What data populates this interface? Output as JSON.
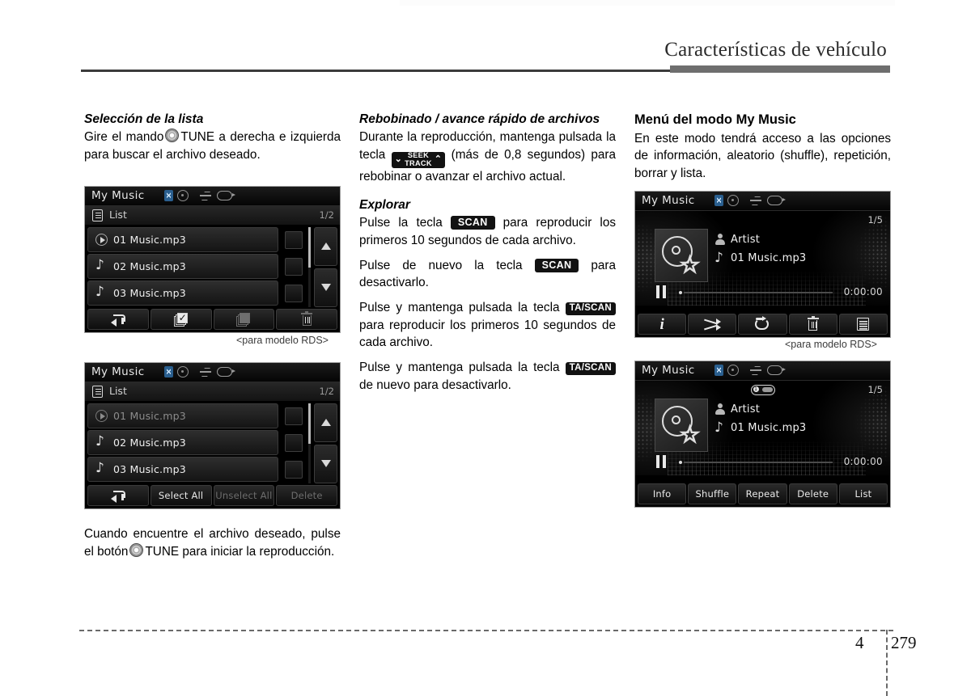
{
  "page": {
    "header_title": "Características de vehículo",
    "chapter": "4",
    "number": "279"
  },
  "columns": {
    "left": {
      "section_title": "Selección de la lista",
      "paragraph_1a": "Gire el mando",
      "paragraph_1b": "TUNE a derecha e izquierda para buscar el archivo deseado.",
      "caption": "<para modelo RDS>",
      "paragraph_2a": "Cuando encuentre el archivo deseado, pulse el botón",
      "paragraph_2b": "TUNE para iniciar la reproducción."
    },
    "middle": {
      "section_title_1": "Rebobinado / avance rápido de archivos",
      "para_1a": "Durante la reproducción, mantenga pulsada la tecla",
      "seek_key_top": "SEEK",
      "seek_key_bottom": "TRACK",
      "para_1b": "(más de 0,8 segundos) para rebobinar o avanzar el archivo actual.",
      "section_title_2": "Explorar",
      "para_2a": "Pulse la tecla",
      "scan_key": "SCAN",
      "para_2b": "para reproducir los primeros 10 segundos de cada archivo.",
      "para_3a": "Pulse de nuevo la tecla",
      "para_3b": "para desactivarlo.",
      "para_4a": "Pulse y mantenga pulsada la tecla",
      "ta_scan_key": "TA/SCAN",
      "para_4b": "para reproducir los primeros 10 segundos de cada archivo.",
      "para_5a": "Pulse y mantenga pulsada la tecla",
      "para_5b": "de nuevo para desactivarlo."
    },
    "right": {
      "section_title": "Menú del modo My Music",
      "paragraph": "En este modo tendrá acceso a las opciones de información, aleatorio (shuffle), repetición, borrar y lista.",
      "caption": "<para modelo RDS>"
    }
  },
  "screens": {
    "list_rds": {
      "title": "My Music",
      "list_label": "List",
      "page_indicator": "1/2",
      "rows": [
        {
          "label": "01 Music.mp3",
          "icon": "play-icon"
        },
        {
          "label": "02 Music.mp3",
          "icon": "music-note-icon"
        },
        {
          "label": "03 Music.mp3",
          "icon": "music-note-icon"
        }
      ],
      "toolbar": [
        {
          "name": "back-button",
          "icon": "back-arrow-icon"
        },
        {
          "name": "select-all-button",
          "icon": "checked-pages-icon"
        },
        {
          "name": "unselect-all-button",
          "icon": "blank-pages-icon"
        },
        {
          "name": "delete-button",
          "icon": "trash-icon"
        }
      ]
    },
    "list_text": {
      "title": "My Music",
      "list_label": "List",
      "page_indicator": "1/2",
      "rows": [
        {
          "label": "01 Music.mp3",
          "icon": "play-icon"
        },
        {
          "label": "02 Music.mp3",
          "icon": "music-note-icon"
        },
        {
          "label": "03 Music.mp3",
          "icon": "music-note-icon"
        }
      ],
      "toolbar": [
        {
          "name": "back-button",
          "label": ""
        },
        {
          "name": "select-all-button",
          "label": "Select All"
        },
        {
          "name": "unselect-all-button",
          "label": "Unselect All"
        },
        {
          "name": "delete-button",
          "label": "Delete"
        }
      ]
    },
    "player_rds": {
      "title": "My Music",
      "page_indicator": "1/5",
      "artist": "Artist",
      "track": "01 Music.mp3",
      "time": "0:00:00",
      "toolbar": [
        {
          "name": "info-button",
          "icon": "info-icon"
        },
        {
          "name": "shuffle-button",
          "icon": "shuffle-icon"
        },
        {
          "name": "repeat-button",
          "icon": "repeat-icon"
        },
        {
          "name": "delete-button",
          "icon": "trash-icon"
        },
        {
          "name": "list-button",
          "icon": "list-icon"
        }
      ]
    },
    "player_text": {
      "title": "My Music",
      "page_indicator": "1/5",
      "badge_number": "1",
      "artist": "Artist",
      "track": "01 Music.mp3",
      "time": "0:00:00",
      "toolbar": [
        {
          "name": "info-button",
          "label": "Info"
        },
        {
          "name": "shuffle-button",
          "label": "Shuffle"
        },
        {
          "name": "repeat-button",
          "label": "Repeat"
        },
        {
          "name": "delete-button",
          "label": "Delete"
        },
        {
          "name": "list-button",
          "label": "List"
        }
      ]
    }
  },
  "colors": {
    "header_rule": "#3b3b3b",
    "header_rule_accent": "#6e6e6e",
    "screen_bg": "#000000",
    "bluetooth_blue": "#2a5f8f"
  }
}
